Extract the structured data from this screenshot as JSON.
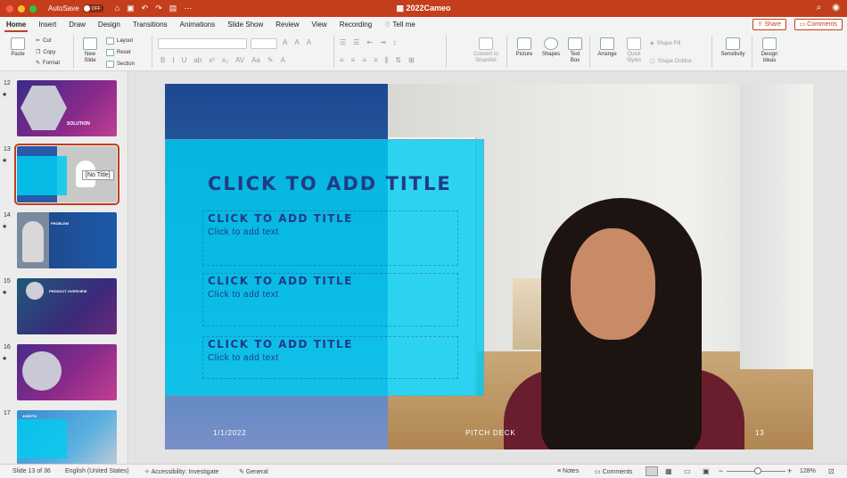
{
  "titlebar": {
    "autosave_label": "AutoSave",
    "autosave_state": "OFF",
    "document_title": "2022Cameo",
    "colors": {
      "bar": "#c43e1c"
    }
  },
  "tabs": [
    {
      "label": "Home",
      "active": true
    },
    {
      "label": "Insert"
    },
    {
      "label": "Draw"
    },
    {
      "label": "Design"
    },
    {
      "label": "Transitions"
    },
    {
      "label": "Animations"
    },
    {
      "label": "Slide Show"
    },
    {
      "label": "Review"
    },
    {
      "label": "View"
    },
    {
      "label": "Recording"
    },
    {
      "label": "Tell me"
    }
  ],
  "share_label": "Share",
  "comments_label": "Comments",
  "ribbon": {
    "paste": "Paste",
    "cut": "Cut",
    "copy": "Copy",
    "format": "Format",
    "new_slide": "New Slide",
    "layout": "Layout",
    "reset": "Reset",
    "section": "Section",
    "convert_smartart": "Convert to SmartArt",
    "picture": "Picture",
    "shapes": "Shapes",
    "text_box": "Text Box",
    "arrange": "Arrange",
    "quick_styles": "Quick Styles",
    "shape_fill": "Shape Fill",
    "shape_outline": "Shape Outline",
    "sensitivity": "Sensitivity",
    "design_ideas": "Design Ideas"
  },
  "thumbnails": [
    {
      "number": "12",
      "star": "★",
      "label": "SOLUTION"
    },
    {
      "number": "13",
      "star": "★",
      "tooltip": "[No Title]",
      "selected": true
    },
    {
      "number": "14",
      "star": "★",
      "label": "PROBLEM"
    },
    {
      "number": "15",
      "star": "★",
      "label": "PRODUCT OVERVIEW"
    },
    {
      "number": "16",
      "star": "★"
    },
    {
      "number": "17",
      "label": "ASSETS"
    }
  ],
  "slide": {
    "main_title": "CLICK TO ADD TITLE",
    "blocks": [
      {
        "title": "CLICK TO ADD TITLE",
        "text": "Click to add text"
      },
      {
        "title": "CLICK TO ADD TITLE",
        "text": "Click to add text"
      },
      {
        "title": "CLICK TO ADD TITLE",
        "text": "Click to add text"
      }
    ],
    "date": "1/1/2022",
    "footer": "PITCH DECK",
    "page_number": "13",
    "colors": {
      "overlay": "#00ccf0",
      "title": "#1f3b84"
    }
  },
  "status": {
    "slide_info": "Slide 13 of 36",
    "language": "English (United States)",
    "accessibility": "Accessibility: Investigate",
    "general": "General",
    "notes": "Notes",
    "comments": "Comments",
    "zoom": "128%"
  }
}
